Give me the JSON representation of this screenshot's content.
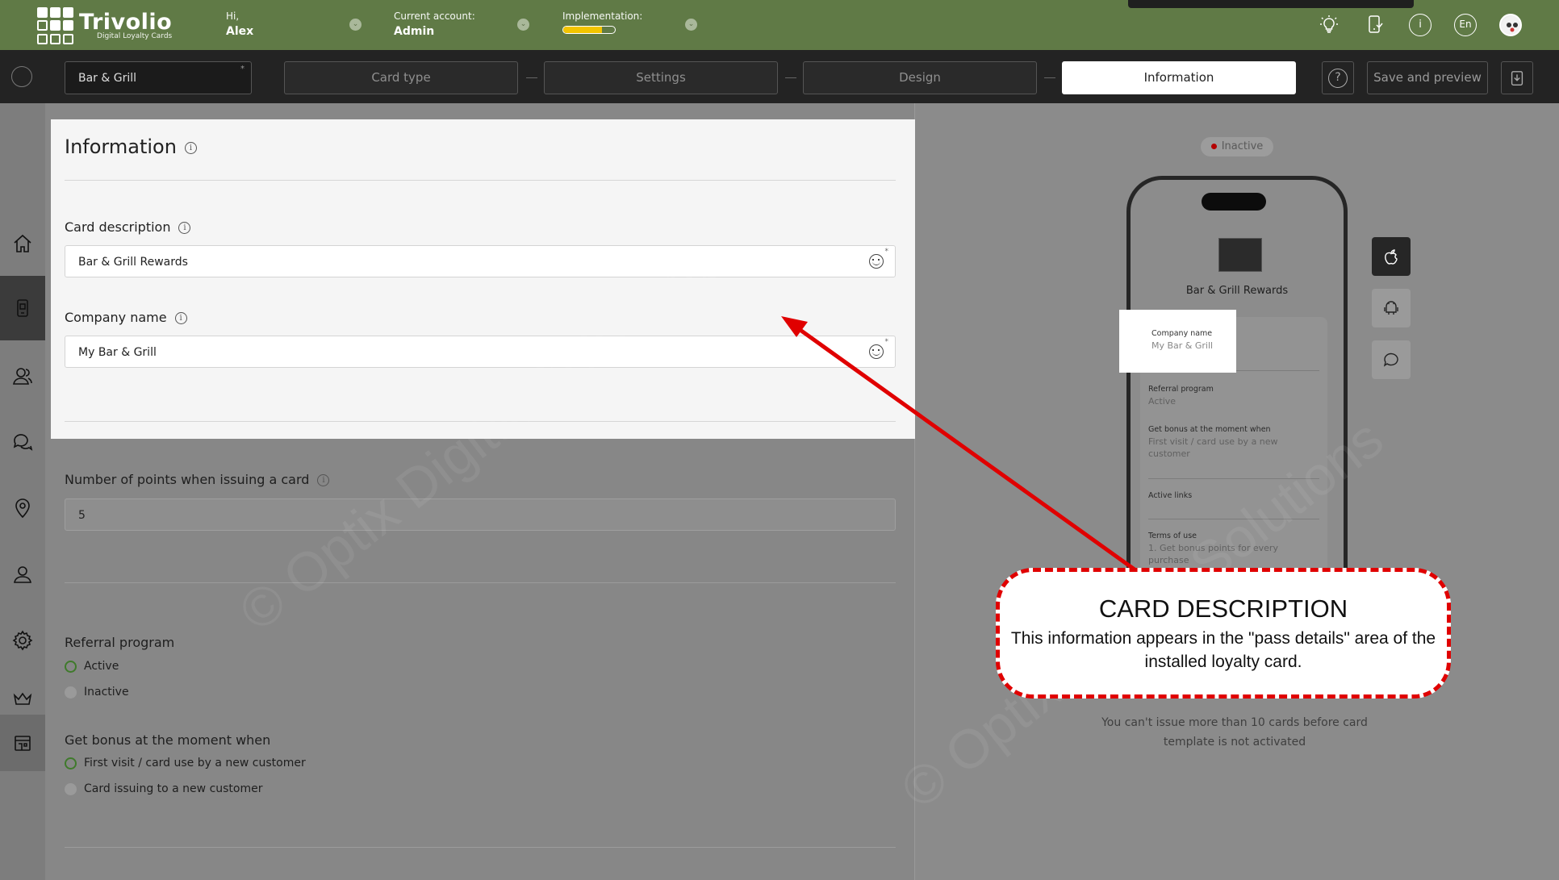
{
  "app": {
    "brand_title": "Trivolio",
    "brand_subtitle": "Digital Loyalty Cards"
  },
  "topbar": {
    "greeting_label": "Hi,",
    "user_name": "Alex",
    "account_label": "Current account:",
    "account_value": "Admin",
    "implementation_label": "Implementation:",
    "implementation_progress": 0.75,
    "language": "En",
    "icons": [
      "lightbulb-icon",
      "phone-icon",
      "info-icon",
      "language-icon",
      "avatar"
    ]
  },
  "steps": {
    "card_name": "Bar & Grill",
    "items": [
      {
        "label": "Card type",
        "active": false
      },
      {
        "label": "Settings",
        "active": false
      },
      {
        "label": "Design",
        "active": false
      },
      {
        "label": "Information",
        "active": true
      }
    ],
    "help_glyph": "?",
    "save_label": "Save and preview"
  },
  "sidebar": {
    "items": [
      "home-icon",
      "card-icon",
      "users-icon",
      "chat-icon",
      "location-icon",
      "profile-icon",
      "settings-icon",
      "crown-icon",
      "store-icon"
    ],
    "active_index": 1
  },
  "form": {
    "title": "Information",
    "card_description_label": "Card description",
    "card_description_value": "Bar & Grill Rewards",
    "company_name_label": "Company name",
    "company_name_value": "My Bar & Grill",
    "points_label": "Number of points when issuing a card",
    "points_value": "5",
    "referral_label": "Referral program",
    "referral_options": [
      "Active",
      "Inactive"
    ],
    "referral_selected": "Active",
    "bonus_label": "Get bonus at the moment when",
    "bonus_options": [
      "First visit / card use by a new customer",
      "Card issuing to a new customer"
    ],
    "bonus_selected": "First visit / card use by a new customer"
  },
  "preview": {
    "status": "Inactive",
    "status_color": "#b40000",
    "card_title": "Bar & Grill Rewards",
    "company_name_label": "Company name",
    "company_name_value": "My Bar & Grill",
    "referral_label": "Referral program",
    "referral_value": "Active",
    "bonus_label": "Get bonus at the moment when",
    "bonus_value": "First visit / card use by a new customer",
    "active_links_label": "Active links",
    "terms_label": "Terms of use",
    "terms_value": "1. Get bonus points for every purchase",
    "platforms": [
      "apple-icon",
      "android-icon",
      "chat-icon"
    ],
    "note": "You can't issue more than 10 cards before card template is not activated"
  },
  "callout": {
    "title": "CARD DESCRIPTION",
    "body": "This information appears in the \"pass details\" area of the installed loyalty card.",
    "border_color": "#e00000"
  },
  "watermark": "© Optix Digital Solutions",
  "colors": {
    "topbar": "#607a46",
    "accent_progress": "#f2c400",
    "radio_on": "#3f7a2b"
  }
}
